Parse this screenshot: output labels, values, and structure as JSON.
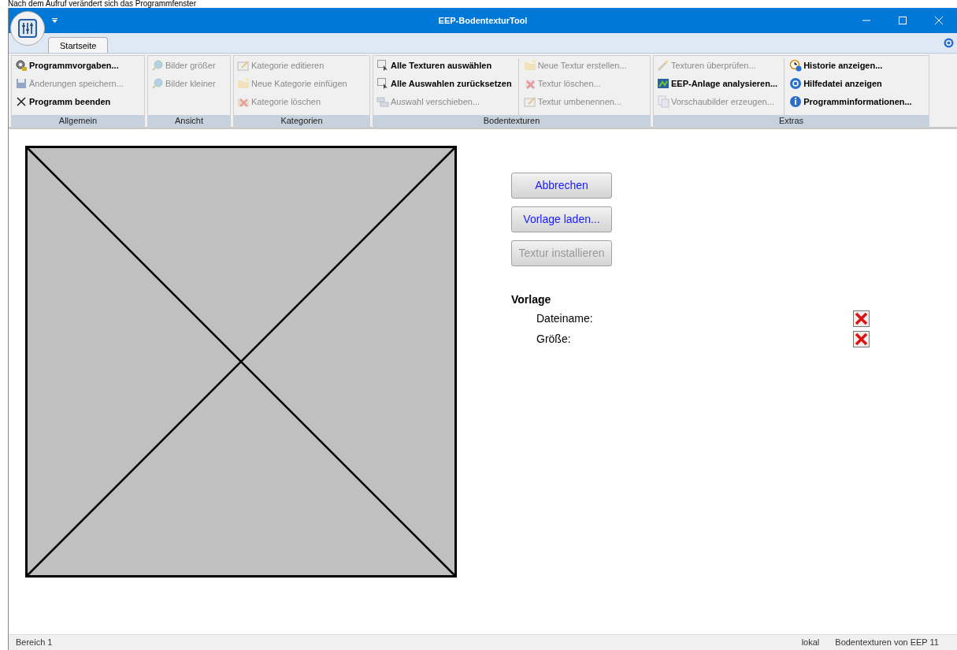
{
  "caption": "Nach dem Aufruf verändert sich das Programmfenster",
  "window": {
    "title": "EEP-BodentexturTool"
  },
  "tabs": [
    {
      "label": "Startseite",
      "selected": true
    }
  ],
  "ribbon": {
    "groups": [
      {
        "label": "Allgemein",
        "columns": [
          [
            {
              "label": "Programmvorgaben...",
              "disabled": false
            },
            {
              "label": "Änderungen speichern...",
              "disabled": true
            },
            {
              "label": "Programm beenden",
              "disabled": false
            }
          ]
        ]
      },
      {
        "label": "Ansicht",
        "columns": [
          [
            {
              "label": "Bilder größer",
              "disabled": true
            },
            {
              "label": "Bilder kleiner",
              "disabled": true
            }
          ]
        ]
      },
      {
        "label": "Kategorien",
        "columns": [
          [
            {
              "label": "Kategorie editieren",
              "disabled": true
            },
            {
              "label": "Neue Kategorie einfügen",
              "disabled": true
            },
            {
              "label": "Kategorie löschen",
              "disabled": true
            }
          ]
        ]
      },
      {
        "label": "Bodentexturen",
        "columns": [
          [
            {
              "label": "Alle Texturen auswählen",
              "disabled": false
            },
            {
              "label": "Alle Auswahlen zurücksetzen",
              "disabled": false
            },
            {
              "label": "Auswahl verschieben...",
              "disabled": true
            }
          ],
          [
            {
              "label": "Neue Textur erstellen...",
              "disabled": true
            },
            {
              "label": "Textur löschen...",
              "disabled": true
            },
            {
              "label": "Textur umbenennen...",
              "disabled": true
            }
          ]
        ]
      },
      {
        "label": "Extras",
        "columns": [
          [
            {
              "label": "Texturen überprüfen...",
              "disabled": true
            },
            {
              "label": "EEP-Anlage analysieren...",
              "disabled": false
            },
            {
              "label": "Vorschaubilder erzeugen...",
              "disabled": true
            }
          ],
          [
            {
              "label": "Historie anzeigen...",
              "disabled": false
            },
            {
              "label": "Hilfedatei anzeigen",
              "disabled": false
            },
            {
              "label": "Programminformationen...",
              "disabled": false
            }
          ]
        ]
      }
    ]
  },
  "buttons": [
    {
      "label": "Abbrechen",
      "disabled": false
    },
    {
      "label": "Vorlage laden...",
      "disabled": false
    },
    {
      "label": "Textur installieren",
      "disabled": true
    }
  ],
  "vorlage": {
    "heading": "Vorlage",
    "fields": [
      {
        "label": "Dateiname:",
        "valid": false
      },
      {
        "label": "Größe:",
        "valid": false
      }
    ]
  },
  "status_bar": {
    "left": "Bereich 1",
    "right": [
      "lokal",
      "Bodentexturen von EEP 11"
    ]
  }
}
